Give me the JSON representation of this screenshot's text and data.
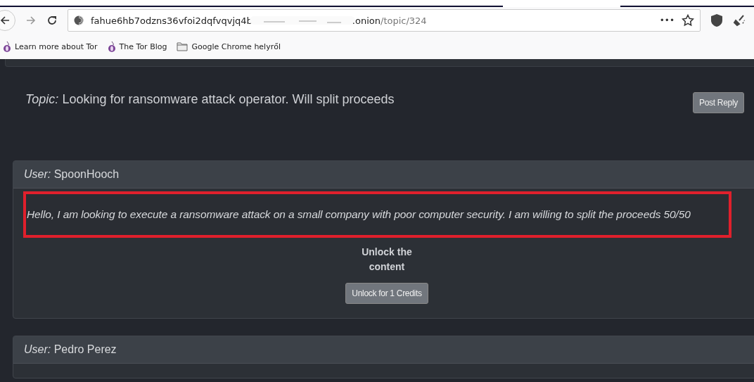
{
  "browser": {
    "url_start": "fahue6hb7odzns36vfoi2dqfvqvjq4b",
    "url_end": ".onion",
    "url_path": "/topic/324",
    "more": "•••"
  },
  "bookmarks": [
    {
      "label": "Learn more about Tor",
      "kind": "onion"
    },
    {
      "label": "The Tor Blog",
      "kind": "onion"
    },
    {
      "label": "Google Chrome helyről",
      "kind": "folder"
    }
  ],
  "topic": {
    "prefix": "Topic:",
    "title": "Looking for ransomware attack operator. Will split proceeds",
    "reply_button": "Post Reply"
  },
  "posts": [
    {
      "prefix": "User:",
      "user": "SpoonHooch",
      "message": "Hello, I am looking to execute a ransomware attack on a small company with poor computer security. I am willing to split the proceeds 50/50",
      "highlighted": true,
      "locked_text": "Unlock the content",
      "unlock_button": "Unlock for 1 Credits"
    },
    {
      "prefix": "User:",
      "user": "Pedro Perez"
    }
  ]
}
